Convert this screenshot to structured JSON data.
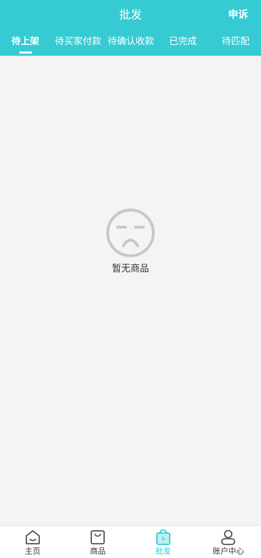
{
  "header": {
    "title": "批发",
    "action_label": "申诉"
  },
  "tabs": [
    {
      "label": "待上架",
      "active": true
    },
    {
      "label": "待买家付款",
      "active": false
    },
    {
      "label": "待确认收款",
      "active": false
    },
    {
      "label": "已完成",
      "active": false
    },
    {
      "label": "待匹配",
      "active": false
    }
  ],
  "empty_state": {
    "icon": "sad-face-icon",
    "text": "暂无商品"
  },
  "bottom_nav": [
    {
      "label": "主页",
      "icon": "home-icon",
      "active": false
    },
    {
      "label": "商品",
      "icon": "shopping-bag-icon",
      "active": false
    },
    {
      "label": "批发",
      "icon": "wholesale-bag-icon",
      "active": true
    },
    {
      "label": "账户中心",
      "icon": "user-icon",
      "active": false
    }
  ],
  "colors": {
    "accent": "#36cad3",
    "background": "#f4f4f4",
    "icon_gray": "#c8c8c8"
  }
}
